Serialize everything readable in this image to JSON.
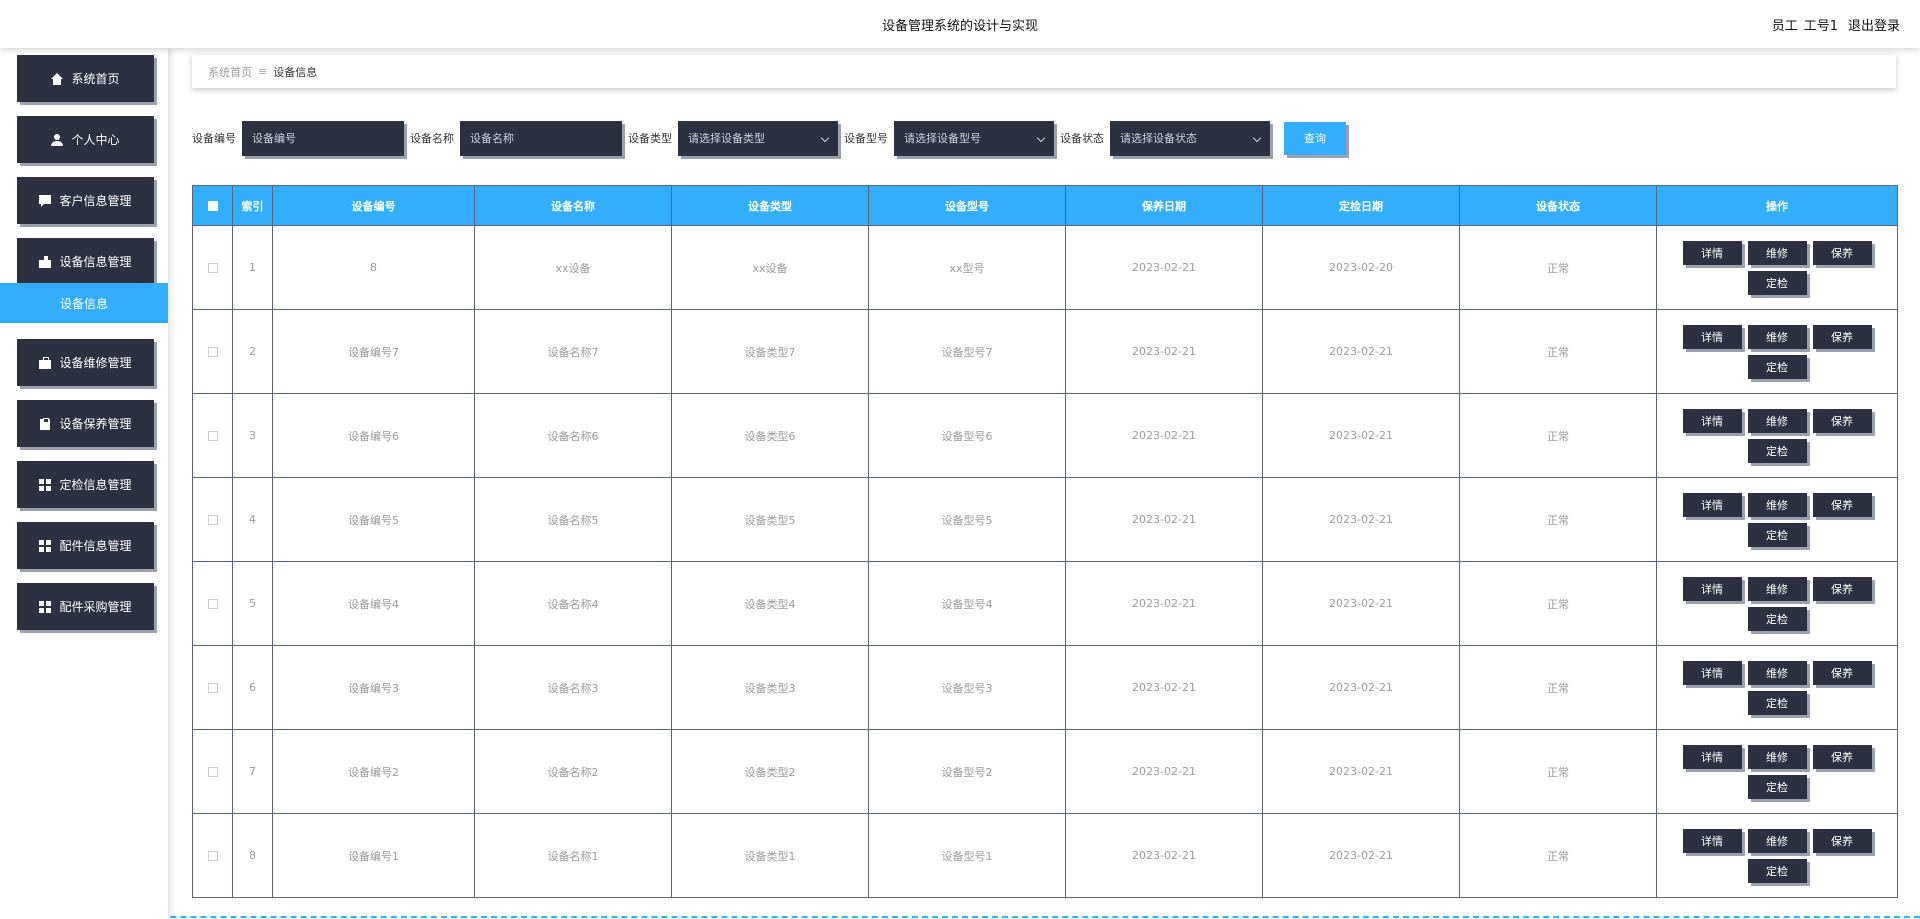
{
  "header": {
    "title": "设备管理系统的设计与实现",
    "role": "员工",
    "username": "工号1",
    "logout": "退出登录"
  },
  "sidebar": {
    "items": [
      {
        "label": "系统首页",
        "icon": "home-icon"
      },
      {
        "label": "个人中心",
        "icon": "user-icon"
      },
      {
        "label": "客户信息管理",
        "icon": "chat-icon"
      },
      {
        "label": "设备信息管理",
        "icon": "thumb-icon"
      },
      {
        "label": "设备维修管理",
        "icon": "briefcase-icon"
      },
      {
        "label": "设备保养管理",
        "icon": "clipboard-icon"
      },
      {
        "label": "定检信息管理",
        "icon": "grid-icon"
      },
      {
        "label": "配件信息管理",
        "icon": "grid-icon"
      },
      {
        "label": "配件采购管理",
        "icon": "grid-icon"
      }
    ],
    "sub_item": "设备信息"
  },
  "breadcrumb": {
    "home": "系统首页",
    "sep": "≡",
    "current": "设备信息"
  },
  "search": {
    "code_label": "设备编号",
    "code_placeholder": "设备编号",
    "name_label": "设备名称",
    "name_placeholder": "设备名称",
    "type_label": "设备类型",
    "type_placeholder": "请选择设备类型",
    "model_label": "设备型号",
    "model_placeholder": "请选择设备型号",
    "status_label": "设备状态",
    "status_placeholder": "请选择设备状态",
    "query": "查询"
  },
  "table": {
    "headers": [
      "索引",
      "设备编号",
      "设备名称",
      "设备类型",
      "设备型号",
      "保养日期",
      "定检日期",
      "设备状态",
      "操作"
    ],
    "ops": [
      "详情",
      "维修",
      "保养",
      "定检"
    ],
    "rows": [
      [
        "1",
        "8",
        "xx设备",
        "xx设备",
        "xx型号",
        "2023-02-21",
        "2023-02-20",
        "正常"
      ],
      [
        "2",
        "设备编号7",
        "设备名称7",
        "设备类型7",
        "设备型号7",
        "2023-02-21",
        "2023-02-21",
        "正常"
      ],
      [
        "3",
        "设备编号6",
        "设备名称6",
        "设备类型6",
        "设备型号6",
        "2023-02-21",
        "2023-02-21",
        "正常"
      ],
      [
        "4",
        "设备编号5",
        "设备名称5",
        "设备类型5",
        "设备型号5",
        "2023-02-21",
        "2023-02-21",
        "正常"
      ],
      [
        "5",
        "设备编号4",
        "设备名称4",
        "设备类型4",
        "设备型号4",
        "2023-02-21",
        "2023-02-21",
        "正常"
      ],
      [
        "6",
        "设备编号3",
        "设备名称3",
        "设备类型3",
        "设备型号3",
        "2023-02-21",
        "2023-02-21",
        "正常"
      ],
      [
        "7",
        "设备编号2",
        "设备名称2",
        "设备类型2",
        "设备型号2",
        "2023-02-21",
        "2023-02-21",
        "正常"
      ],
      [
        "8",
        "设备编号1",
        "设备名称1",
        "设备类型1",
        "设备型号1",
        "2023-02-21",
        "2023-02-21",
        "正常"
      ]
    ]
  },
  "colors": {
    "accent": "#33aefc",
    "dark": "#2c3040"
  }
}
